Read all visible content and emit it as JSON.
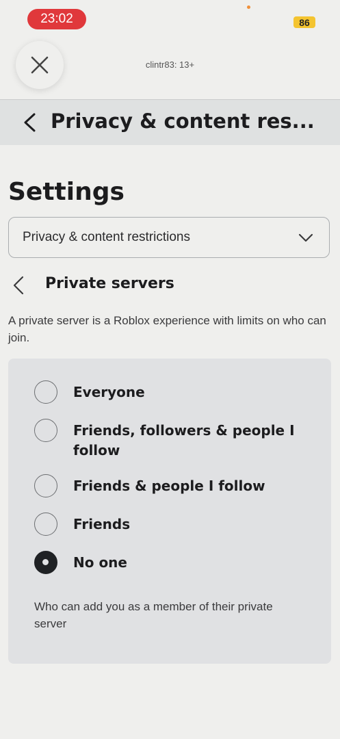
{
  "status_bar": {
    "time": "23:02",
    "battery": "86",
    "accent_colors": {
      "time_pill": "#e0383b",
      "battery": "#f4c430"
    }
  },
  "account": {
    "label": "clintr83: 13+"
  },
  "header": {
    "title": "Privacy & content res..."
  },
  "settings": {
    "title": "Settings",
    "dropdown": {
      "selected": "Privacy & content restrictions"
    }
  },
  "section": {
    "title": "Private servers",
    "description": "A private server is a Roblox experience with limits on who can join."
  },
  "options": [
    {
      "label": "Everyone",
      "selected": false
    },
    {
      "label": "Friends, followers & people I follow",
      "selected": false
    },
    {
      "label": "Friends & people I follow",
      "selected": false
    },
    {
      "label": "Friends",
      "selected": false
    },
    {
      "label": "No one",
      "selected": true
    }
  ],
  "footnote": "Who can add you as a member of their private server"
}
